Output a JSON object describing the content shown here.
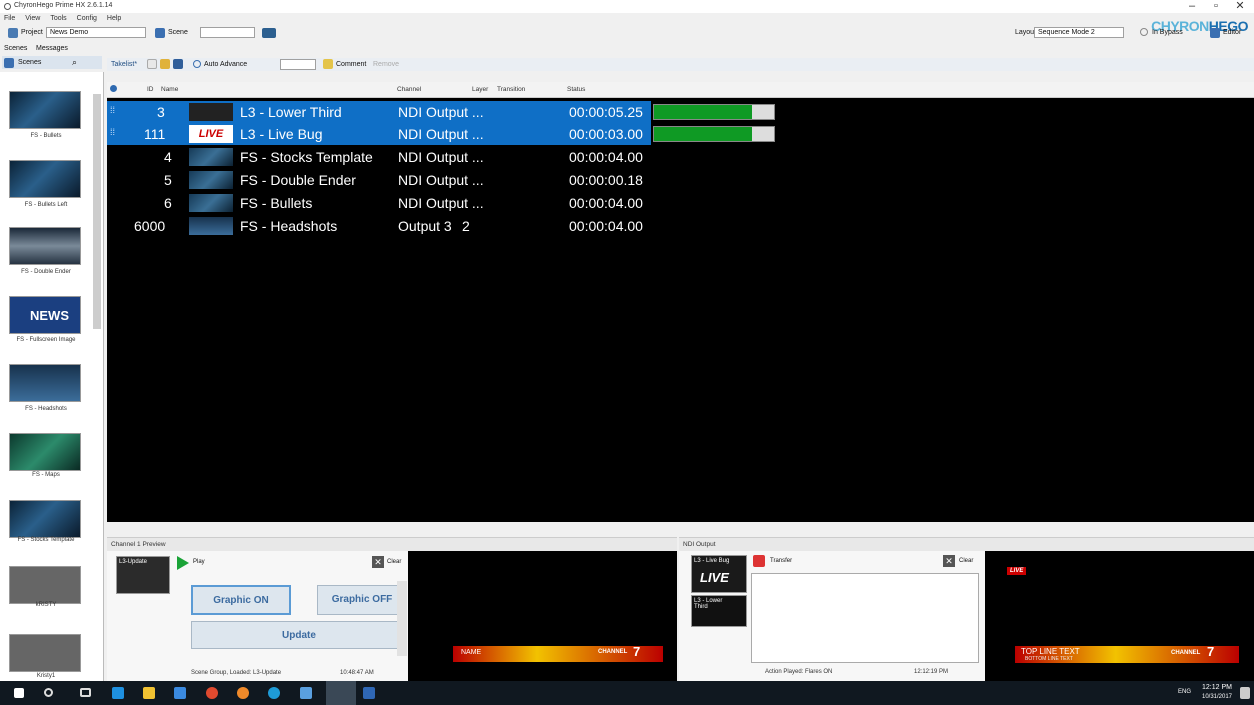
{
  "window": {
    "title": "ChyronHego Prime HX 2.6.1.14",
    "logo_a": "CHYRON",
    "logo_b": "HEGO"
  },
  "menu": [
    "File",
    "View",
    "Tools",
    "Config",
    "Help"
  ],
  "toolbar1": {
    "project_label": "Project",
    "project_value": "News Demo",
    "scene_label": "Scene",
    "layout_label": "Layout",
    "layout_value": "Sequence Mode 2",
    "bypass_label": "In Bypass",
    "editor_label": "Editor"
  },
  "left_tabs": {
    "scenes": "Scenes",
    "messages": "Messages",
    "scenes_dropdown": "Scenes"
  },
  "thumbnails": [
    "FS - Bullets",
    "FS - Bullets Left",
    "FS - Double Ender",
    "FS - Fullscreen Image",
    "FS - Headshots",
    "FS - Maps",
    "FS - Stocks Template",
    "kRISTY",
    "Kristy1"
  ],
  "news_thumb_text": "NEWS",
  "toolbar2": {
    "takelist": "Takelist*",
    "auto_advance": "Auto Advance",
    "comment": "Comment",
    "remove": "Remove"
  },
  "table": {
    "headers": {
      "id": "ID",
      "name": "Name",
      "channel": "Channel",
      "layer": "Layer",
      "transition": "Transition",
      "status": "Status"
    },
    "rows": [
      {
        "id": "3",
        "name": "L3 - Lower Third",
        "channel": "NDI Output ...",
        "layer": "",
        "status": "00:00:05.25",
        "selected": true,
        "progress": 0.82
      },
      {
        "id": "111",
        "name": "L3 - Live Bug",
        "channel": "NDI Output ...",
        "layer": "",
        "status": "00:00:03.00",
        "selected": true,
        "progress": 0.82,
        "badge": "LIVE"
      },
      {
        "id": "4",
        "name": "FS - Stocks Template",
        "channel": "NDI Output ...",
        "layer": "",
        "status": "00:00:04.00",
        "selected": false
      },
      {
        "id": "5",
        "name": "FS - Double Ender",
        "channel": "NDI Output ...",
        "layer": "",
        "status": "00:00:00.18",
        "selected": false
      },
      {
        "id": "6",
        "name": "FS - Bullets",
        "channel": "NDI Output ...",
        "layer": "",
        "status": "00:00:04.00",
        "selected": false
      },
      {
        "id": "6000",
        "name": "FS - Headshots",
        "channel": "Output 3",
        "layer": "2",
        "status": "00:00:04.00",
        "selected": false
      }
    ]
  },
  "preview_panel": {
    "title": "Channel 1 Preview",
    "thumb_label": "L3-Update",
    "play": "Play",
    "clear": "Clear",
    "graphic_on": "Graphic ON",
    "graphic_off": "Graphic OFF",
    "update": "Update",
    "status": "Scene Group, Loaded: L3-Update",
    "time": "10:48:47 AM"
  },
  "output_panel": {
    "title": "NDI Output",
    "thumb1_label": "L3 - Live Bug",
    "thumb1_badge": "LIVE",
    "thumb2_label": "L3 - Lower Third",
    "transfer": "Transfer",
    "clear": "Clear",
    "status": "Action Played: Flares ON",
    "time": "12:12:19 PM"
  },
  "preview_graphics": {
    "channel_text": "CHANNEL",
    "channel_num": "7",
    "name_text": "NAME",
    "top_line": "TOP LINE TEXT",
    "bottom_line": "BOTTOM LINE TEXT",
    "live": "LIVE"
  },
  "taskbar": {
    "lang": "ENG",
    "time": "12:12 PM",
    "date": "10/31/2017"
  }
}
